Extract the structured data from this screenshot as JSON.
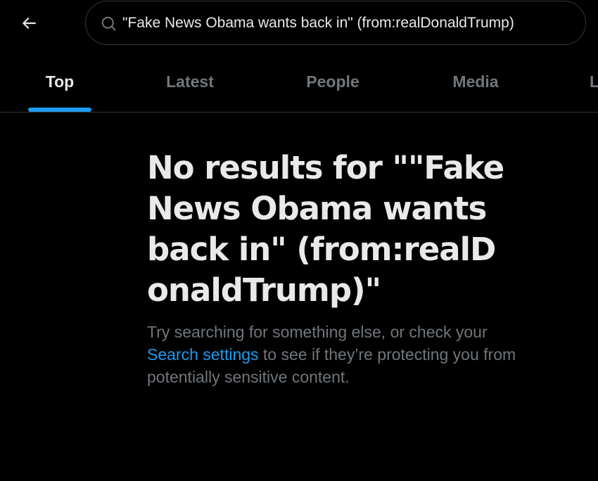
{
  "header": {
    "back_icon": "arrow-left-icon",
    "search": {
      "icon": "search-icon",
      "value": "\"Fake News Obama wants back in\" (from:realDonaldTrump)"
    }
  },
  "tabs": [
    {
      "label": "Top",
      "active": true
    },
    {
      "label": "Latest",
      "active": false
    },
    {
      "label": "People",
      "active": false
    },
    {
      "label": "Media",
      "active": false
    },
    {
      "label": "L",
      "active": false
    }
  ],
  "empty_state": {
    "title": "No results for \"\"Fake News Obama wants back in\" (from:realDonaldTrump)\"",
    "desc_before": "Try searching for something else, or check your ",
    "link_text": "Search settings",
    "desc_after": " to see if they’re protecting you from potentially sensitive content."
  },
  "colors": {
    "background": "#000000",
    "text_primary": "#e7e9ea",
    "text_secondary": "#71767b",
    "accent": "#1d9bf0",
    "border": "#2f3336"
  }
}
